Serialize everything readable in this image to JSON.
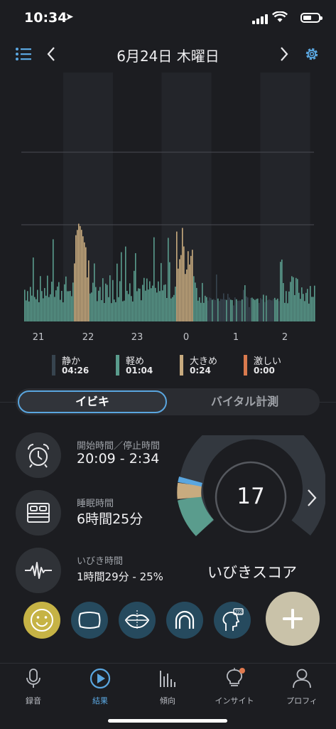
{
  "status": {
    "time": "10:34",
    "location_icon": "location-arrow-icon"
  },
  "nav": {
    "title": "6月24日 木曜日",
    "menu_icon": "list-icon",
    "prev_icon": "chevron-left-icon",
    "next_icon": "chevron-right-icon",
    "settings_icon": "gear-icon"
  },
  "colors": {
    "quiet": "#37444f",
    "light": "#5a9c8d",
    "loud": "#c8ab7f",
    "epic": "#d97a4e",
    "accent": "#5aa6df"
  },
  "chart_data": {
    "type": "bar",
    "title": "",
    "xlabel": "",
    "ylabel": "",
    "x_ticks": [
      "21",
      "22",
      "23",
      "0",
      "1",
      "2"
    ],
    "series": [
      {
        "name": "静か",
        "duration": "04:26"
      },
      {
        "name": "軽め",
        "duration": "01:04"
      },
      {
        "name": "大きめ",
        "duration": "0:24"
      },
      {
        "name": "激しい",
        "duration": "0:00"
      }
    ],
    "loud_periods": [
      "~22:00",
      "~0:00"
    ],
    "grid": "horizontal, 2 lines"
  },
  "legend": [
    {
      "label": "静か",
      "value": "04:26",
      "color": "#37444f"
    },
    {
      "label": "軽め",
      "value": "01:04",
      "color": "#5a9c8d"
    },
    {
      "label": "大きめ",
      "value": "0:24",
      "color": "#c8ab7f"
    },
    {
      "label": "激しい",
      "value": "0:00",
      "color": "#d97a4e"
    }
  ],
  "tabs_segment": {
    "active": "イビキ",
    "inactive": "バイタル計測"
  },
  "stats": {
    "start_stop": {
      "label": "開始時間／停止時間",
      "value": "20:09 - 2:34",
      "icon": "alarm-clock-icon"
    },
    "sleep": {
      "label": "睡眠時間",
      "value": "6時間25分",
      "icon": "bed-icon"
    },
    "snore": {
      "label": "いびき時間",
      "value": "1時間29分 - 25%",
      "icon": "waveform-icon"
    }
  },
  "score": {
    "value": "17",
    "label": "いびきスコア",
    "light_fraction": 0.18,
    "loud_fraction": 0.1
  },
  "factor_icons": [
    "smiley-icon",
    "pillow-icon",
    "mouth-icon",
    "mouthguard-icon",
    "sleep-head-icon"
  ],
  "fab_icon": "plus-icon",
  "tabbar": [
    {
      "label": "録音",
      "icon": "microphone-icon"
    },
    {
      "label": "結果",
      "icon": "play-icon"
    },
    {
      "label": "傾向",
      "icon": "bars-icon"
    },
    {
      "label": "インサイト",
      "icon": "lightbulb-icon"
    },
    {
      "label": "プロフィ",
      "icon": "person-icon"
    }
  ]
}
